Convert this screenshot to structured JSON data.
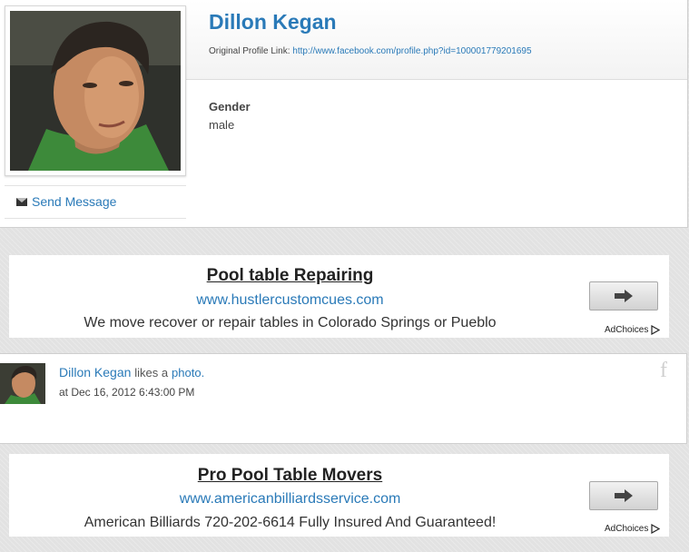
{
  "profile": {
    "name": "Dillon Kegan",
    "link_label": "Original Profile Link:",
    "link_url": "http://www.facebook.com/profile.php?id=100001779201695",
    "gender_label": "Gender",
    "gender_value": "male",
    "send_message_label": "Send Message"
  },
  "ads": [
    {
      "title": "Pool table Repairing",
      "url": "www.hustlercustomcues.com",
      "description": "We move recover or repair tables in Colorado Springs or Pueblo",
      "adchoices_label": "AdChoices"
    },
    {
      "title": "Pro Pool Table Movers",
      "url": "www.americanbilliardsservice.com",
      "description": "American Billiards 720-202-6614 Fully Insured And Guaranteed!",
      "adchoices_label": "AdChoices"
    }
  ],
  "activity": {
    "actor": "Dillon Kegan",
    "verb": "likes a",
    "object": "photo.",
    "timestamp": "at Dec 16, 2012 6:43:00 PM",
    "source_icon": "facebook-icon"
  },
  "colors": {
    "link_blue": "#2a7ab8",
    "page_background": "#e2e2e2",
    "card_background": "#ffffff"
  }
}
